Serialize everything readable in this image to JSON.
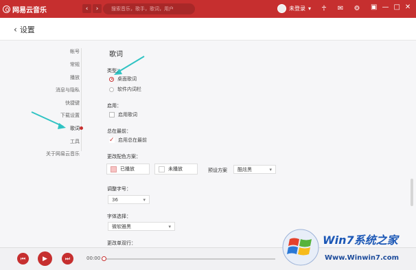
{
  "titlebar": {
    "app_name": "网易云音乐",
    "search_placeholder": "搜索音乐，歌手，歌词，用户",
    "user_status": "未登录",
    "accent": "#c62f2f"
  },
  "subbar": {
    "back_label": "设置"
  },
  "sidebar": {
    "items": [
      {
        "label": "帐号"
      },
      {
        "label": "常规"
      },
      {
        "label": "播放"
      },
      {
        "label": "消息与隐私"
      },
      {
        "label": "快捷键"
      },
      {
        "label": "下载设置"
      },
      {
        "label": "歌词"
      },
      {
        "label": "工具"
      },
      {
        "label": "关于网易云音乐"
      }
    ],
    "active": "歌词"
  },
  "lyrics": {
    "title": "歌词",
    "type_label": "类型：",
    "type_options": [
      {
        "label": "桌面歌词",
        "selected": true
      },
      {
        "label": "软件内词栏",
        "selected": false
      }
    ],
    "enable_label": "启用：",
    "enable_option": {
      "label": "启用歌词",
      "checked": false
    },
    "ontop_label": "总在最前：",
    "ontop_option": {
      "label": "启用总在最前",
      "checked": true
    },
    "color_label": "更改配色方案：",
    "played_label": "已播放",
    "unplayed_label": "未播放",
    "preset_label": "预设方案",
    "preset_value": "酷炫黑",
    "fontsize_label": "调整字号：",
    "fontsize_value": "36",
    "font_label": "字体选择：",
    "font_value": "微软雅黑",
    "lines_label": "更改单双行："
  },
  "player": {
    "time": "00:00",
    "progress": 0
  },
  "watermark": {
    "brand": "Win7系统之家",
    "url": "Www.Winwin7.com"
  }
}
